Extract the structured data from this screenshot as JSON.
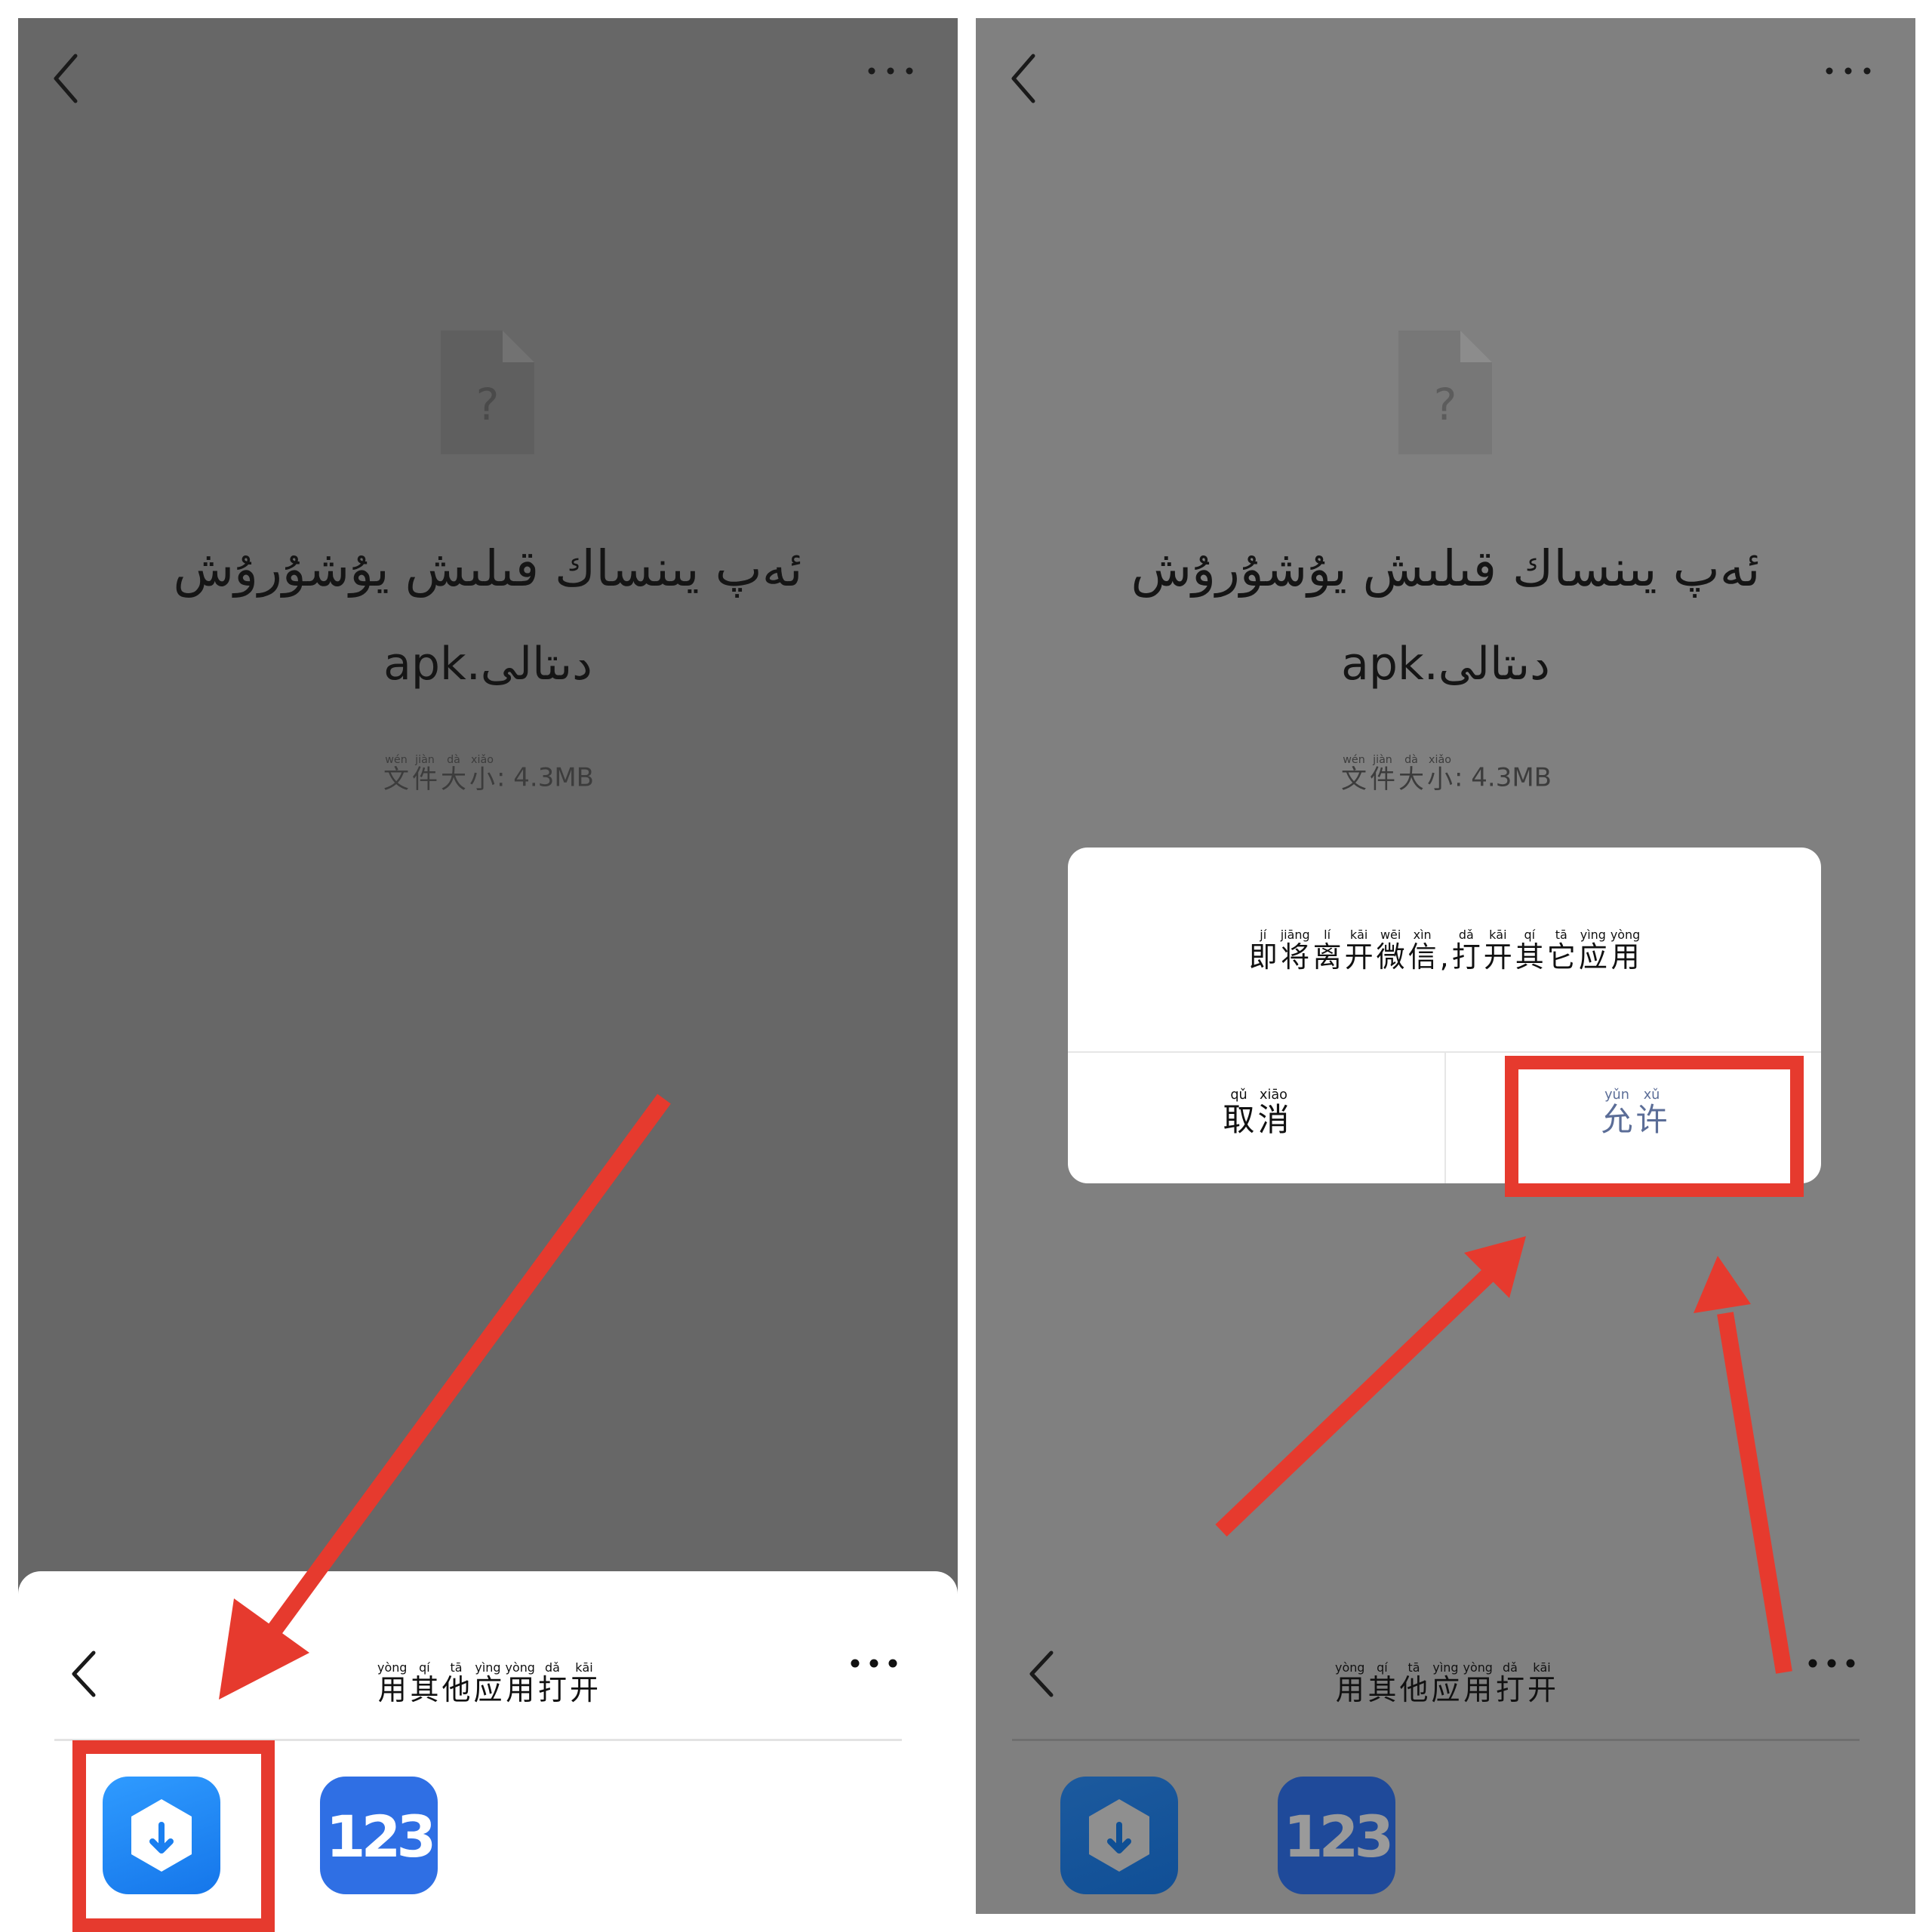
{
  "left_screen": {
    "file_name_line1": "ئەپ يىنساك قىلىش يۇشۇرۇش",
    "file_name_line2": "apk.دىتالى",
    "file_size": {
      "label_chars": [
        {
          "py": "wén",
          "hz": "文"
        },
        {
          "py": "jiàn",
          "hz": "件"
        },
        {
          "py": "dà",
          "hz": "大"
        },
        {
          "py": "xiǎo",
          "hz": "小"
        }
      ],
      "value": ": 4.3MB"
    },
    "sheet": {
      "title_chars": [
        {
          "py": "yòng",
          "hz": "用"
        },
        {
          "py": "qí",
          "hz": "其"
        },
        {
          "py": "tā",
          "hz": "他"
        },
        {
          "py": "yìng",
          "hz": "应"
        },
        {
          "py": "yòng",
          "hz": "用"
        },
        {
          "py": "dǎ",
          "hz": "打"
        },
        {
          "py": "kāi",
          "hz": "开"
        }
      ],
      "apps": [
        {
          "icon": "download-app-icon"
        },
        {
          "icon": "app-123-icon",
          "text": "123"
        }
      ]
    }
  },
  "right_screen": {
    "file_name_line1": "ئەپ يىنساك قىلىش يۇشۇرۇش",
    "file_name_line2": "apk.دىتالى",
    "file_size": {
      "label_chars": [
        {
          "py": "wén",
          "hz": "文"
        },
        {
          "py": "jiàn",
          "hz": "件"
        },
        {
          "py": "dà",
          "hz": "大"
        },
        {
          "py": "xiǎo",
          "hz": "小"
        }
      ],
      "value": ": 4.3MB"
    },
    "dialog": {
      "message_chars": [
        {
          "py": "jí",
          "hz": "即"
        },
        {
          "py": "jiāng",
          "hz": "将"
        },
        {
          "py": "lí",
          "hz": "离"
        },
        {
          "py": "kāi",
          "hz": "开"
        },
        {
          "py": "wēi",
          "hz": "微"
        },
        {
          "py": "xìn",
          "hz": "信"
        },
        {
          "py": "",
          "hz": ","
        },
        {
          "py": "dǎ",
          "hz": "打"
        },
        {
          "py": "kāi",
          "hz": "开"
        },
        {
          "py": "qí",
          "hz": "其"
        },
        {
          "py": "tā",
          "hz": "它"
        },
        {
          "py": "yìng",
          "hz": "应"
        },
        {
          "py": "yòng",
          "hz": "用"
        }
      ],
      "cancel_chars": [
        {
          "py": "qǔ",
          "hz": "取"
        },
        {
          "py": "xiāo",
          "hz": "消"
        }
      ],
      "allow_chars": [
        {
          "py": "yǔn",
          "hz": "允"
        },
        {
          "py": "xǔ",
          "hz": "许"
        }
      ]
    },
    "sheet": {
      "title_chars": [
        {
          "py": "yòng",
          "hz": "用"
        },
        {
          "py": "qí",
          "hz": "其"
        },
        {
          "py": "tā",
          "hz": "他"
        },
        {
          "py": "yìng",
          "hz": "应"
        },
        {
          "py": "yòng",
          "hz": "用"
        },
        {
          "py": "dǎ",
          "hz": "打"
        },
        {
          "py": "kāi",
          "hz": "开"
        }
      ]
    }
  },
  "colors": {
    "highlight": "#e63a2e",
    "allow_text": "#5b6d97",
    "left_bg": "#676767",
    "right_bg": "#808080"
  }
}
